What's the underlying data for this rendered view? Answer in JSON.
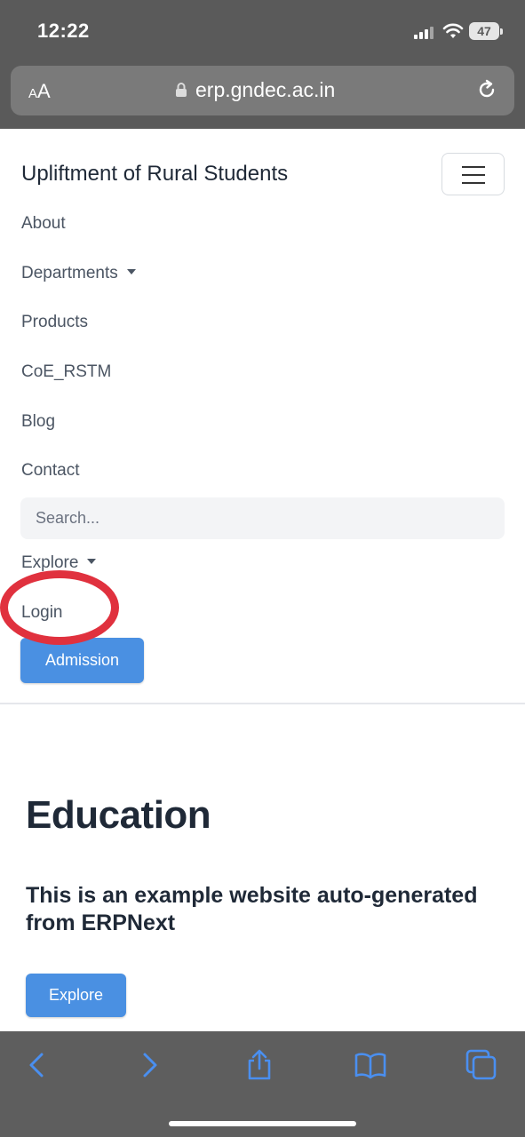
{
  "status_bar": {
    "time": "12:22",
    "battery": "47"
  },
  "browser": {
    "text_size_label_small": "A",
    "text_size_label_large": "A",
    "url": "erp.gndec.ac.in"
  },
  "navbar": {
    "brand": "Upliftment of Rural Students",
    "items": [
      {
        "label": "About",
        "dropdown": false
      },
      {
        "label": "Departments",
        "dropdown": true
      },
      {
        "label": "Products",
        "dropdown": false
      },
      {
        "label": "CoE_RSTM",
        "dropdown": false
      },
      {
        "label": "Blog",
        "dropdown": false
      },
      {
        "label": "Contact",
        "dropdown": false
      }
    ],
    "search_placeholder": "Search...",
    "explore_label": "Explore",
    "login_label": "Login",
    "admission_label": "Admission"
  },
  "hero": {
    "title": "Education",
    "subtitle": "This is an example website auto-generated from ERPNext",
    "button_label": "Explore"
  },
  "colors": {
    "primary": "#4a90e2",
    "highlight_circle": "#e0313e",
    "text_dark": "#1f2937",
    "chrome": "#5a5a5a"
  }
}
